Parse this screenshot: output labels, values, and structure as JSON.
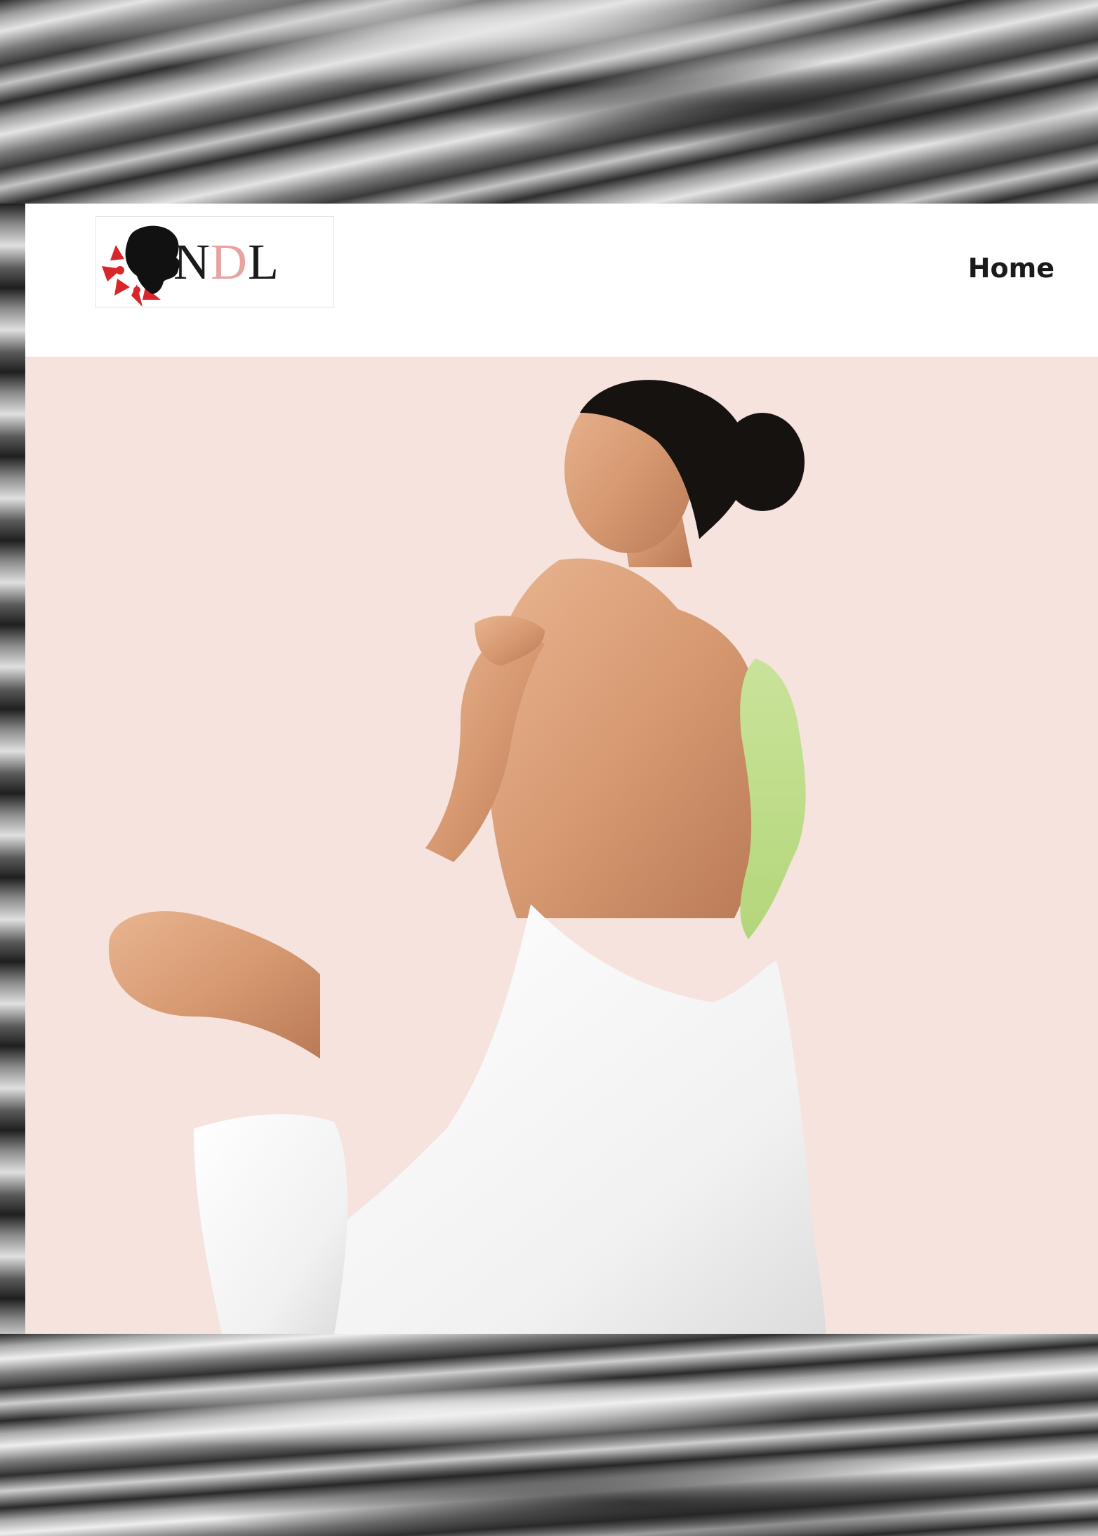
{
  "logo": {
    "letters": [
      "N",
      "D",
      "L"
    ],
    "accent_color": "#e8a2a2",
    "flower_color": "#d8262a"
  },
  "nav": {
    "home_label": "Home"
  },
  "hero": {
    "background_color": "#f6e3de",
    "image": "woman-in-towel-with-green-body-mask"
  }
}
